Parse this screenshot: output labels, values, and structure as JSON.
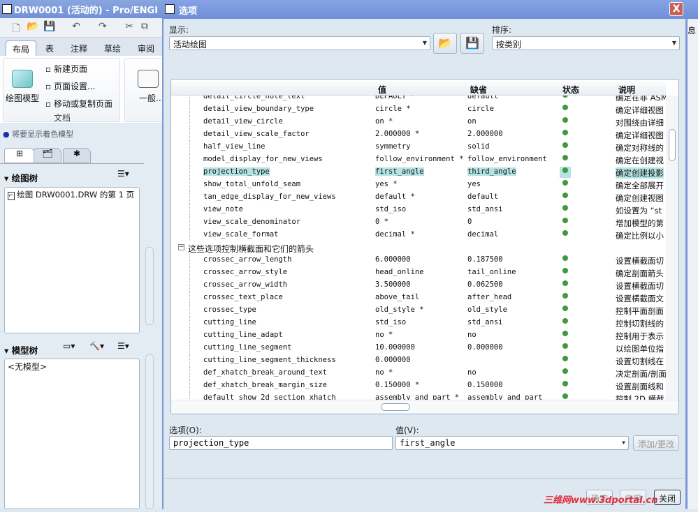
{
  "main_window": {
    "title": "DRW0001 (活动的) - Pro/ENGI",
    "ribbon_tabs": [
      "布局",
      "表",
      "注释",
      "草绘",
      "审阅"
    ],
    "document_group": {
      "label": "文档",
      "big_button": "绘图模型",
      "items": [
        "新建页面",
        "页面设置...",
        "移动或复制页面"
      ],
      "next_button": "一般..."
    },
    "status_hint": "将要显示着色模型",
    "drawing_tree": {
      "title": "绘图树",
      "items": [
        "绘图 DRW0001.DRW 的第 1 页"
      ]
    },
    "model_tree": {
      "title": "模型树",
      "items": [
        "<无模型>"
      ]
    },
    "right_peek": "息"
  },
  "dialog": {
    "title": "选项",
    "close_label": "X",
    "show_label": "显示:",
    "show_value": "活动绘图",
    "sort_label": "排序:",
    "sort_value": "按类别",
    "columns": [
      "",
      "值",
      "缺省",
      "状态",
      "说明"
    ],
    "rows": [
      {
        "name": "detail_circle_note_text",
        "value": "DEFAULT *",
        "default": "default",
        "status": "green",
        "desc": "确定在非 ASM"
      },
      {
        "name": "detail_view_boundary_type",
        "value": "circle *",
        "default": "circle",
        "status": "green",
        "desc": "确定详细视图"
      },
      {
        "name": "detail_view_circle",
        "value": "on *",
        "default": "on",
        "status": "green",
        "desc": "对围绕由详细"
      },
      {
        "name": "detail_view_scale_factor",
        "value": "2.000000 *",
        "default": "2.000000",
        "status": "green",
        "desc": "确定详细视图"
      },
      {
        "name": "half_view_line",
        "value": "symmetry",
        "default": "solid",
        "status": "green",
        "desc": "确定对称线的"
      },
      {
        "name": "model_display_for_new_views",
        "value": "follow_environment *",
        "default": "follow_environment",
        "status": "green",
        "desc": "确定在创建视"
      },
      {
        "name": "projection_type",
        "value": "first_angle",
        "default": "third_angle",
        "status": "green",
        "desc": "确定创建投影",
        "selected": true
      },
      {
        "name": "show_total_unfold_seam",
        "value": "yes *",
        "default": "yes",
        "status": "green",
        "desc": "确定全部展开"
      },
      {
        "name": "tan_edge_display_for_new_views",
        "value": "default *",
        "default": "default",
        "status": "green",
        "desc": "确定创建视图"
      },
      {
        "name": "view_note",
        "value": "std_iso",
        "default": "std_ansi",
        "status": "green",
        "desc": "如设置为 “st"
      },
      {
        "name": "view_scale_denominator",
        "value": "0 *",
        "default": "0",
        "status": "green",
        "desc": "增加模型的第"
      },
      {
        "name": "view_scale_format",
        "value": "decimal *",
        "default": "decimal",
        "status": "green",
        "desc": "确定比例以小"
      },
      {
        "group": "这些选项控制横截面和它们的箭头"
      },
      {
        "name": "crossec_arrow_length",
        "value": "6.000000",
        "default": "0.187500",
        "status": "green",
        "desc": "设置横截面切"
      },
      {
        "name": "crossec_arrow_style",
        "value": "head_online",
        "default": "tail_online",
        "status": "green",
        "desc": "确定剖面箭头"
      },
      {
        "name": "crossec_arrow_width",
        "value": "3.500000",
        "default": "0.062500",
        "status": "green",
        "desc": "设置横截面切"
      },
      {
        "name": "crossec_text_place",
        "value": "above_tail",
        "default": "after_head",
        "status": "green",
        "desc": "设置横截面文"
      },
      {
        "name": "crossec_type",
        "value": "old_style *",
        "default": "old_style",
        "status": "green",
        "desc": "控制平面剖面"
      },
      {
        "name": "cutting_line",
        "value": "std_iso",
        "default": "std_ansi",
        "status": "green",
        "desc": "控制切割线的"
      },
      {
        "name": "cutting_line_adapt",
        "value": "no *",
        "default": "no",
        "status": "green",
        "desc": "控制用于表示"
      },
      {
        "name": "cutting_line_segment",
        "value": "10.000000",
        "default": "0.000000",
        "status": "green",
        "desc": "以绘图单位指"
      },
      {
        "name": "cutting_line_segment_thickness",
        "value": "0.000000",
        "default": "",
        "status": "green",
        "desc": "设置切割线在"
      },
      {
        "name": "def_xhatch_break_around_text",
        "value": "no *",
        "default": "no",
        "status": "green",
        "desc": "决定剖面/剖面"
      },
      {
        "name": "def_xhatch_break_margin_size",
        "value": "0.150000 *",
        "default": "0.150000",
        "status": "green",
        "desc": "设置剖面线和"
      },
      {
        "name": "default_show_2d_section_xhatch",
        "value": "assembly_and_part *",
        "default": "assembly_and_part",
        "status": "green",
        "desc": "控制 2D 横截"
      }
    ],
    "option_label": "选项(O):",
    "option_value": "projection_type",
    "value_label": "值(V):",
    "value_value": "first_angle",
    "add_change_label": "添加/更改",
    "ok_label": "确定",
    "apply_label": "应用",
    "close_button_label": "关闭",
    "watermark": "三维网www.3dportal.cn",
    "status_color": "#3f9a3f",
    "selection_color": "#b5e3e3"
  }
}
